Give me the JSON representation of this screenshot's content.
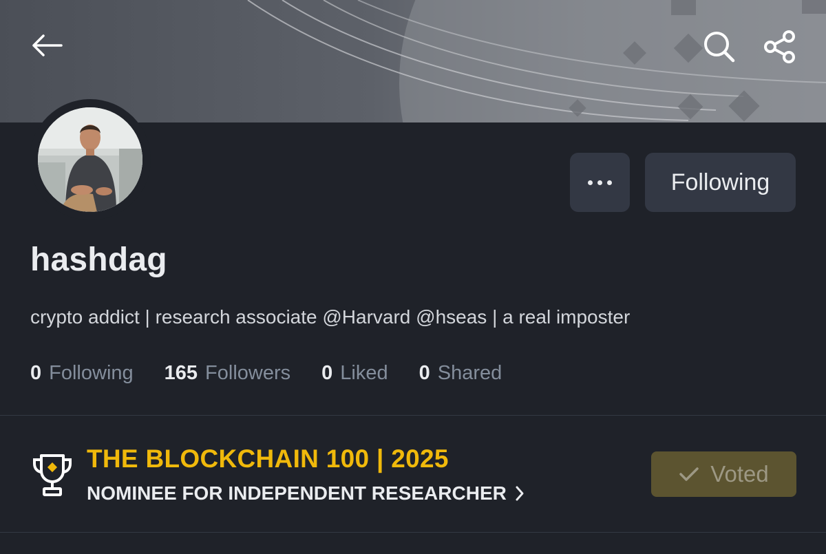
{
  "header": {
    "back_icon": "arrow-left-icon",
    "search_icon": "search-icon",
    "share_icon": "share-icon"
  },
  "profile": {
    "username": "hashdag",
    "bio": "crypto addict | research associate @Harvard @hseas | a real imposter",
    "more_icon": "more-horizontal-icon",
    "follow_label": "Following"
  },
  "stats": [
    {
      "value": "0",
      "label": "Following"
    },
    {
      "value": "165",
      "label": "Followers"
    },
    {
      "value": "0",
      "label": "Liked"
    },
    {
      "value": "0",
      "label": "Shared"
    }
  ],
  "award": {
    "icon": "trophy-icon",
    "title": "THE BLOCKCHAIN 100 | 2025",
    "subtitle": "NOMINEE FOR INDEPENDENT RESEARCHER",
    "chevron_icon": "chevron-right-icon",
    "vote_label": "Voted",
    "vote_icon": "check-icon"
  },
  "colors": {
    "background": "#1f2229",
    "accent": "#f0b90b",
    "button_bg": "#333844",
    "voted_bg": "#5c5430"
  }
}
